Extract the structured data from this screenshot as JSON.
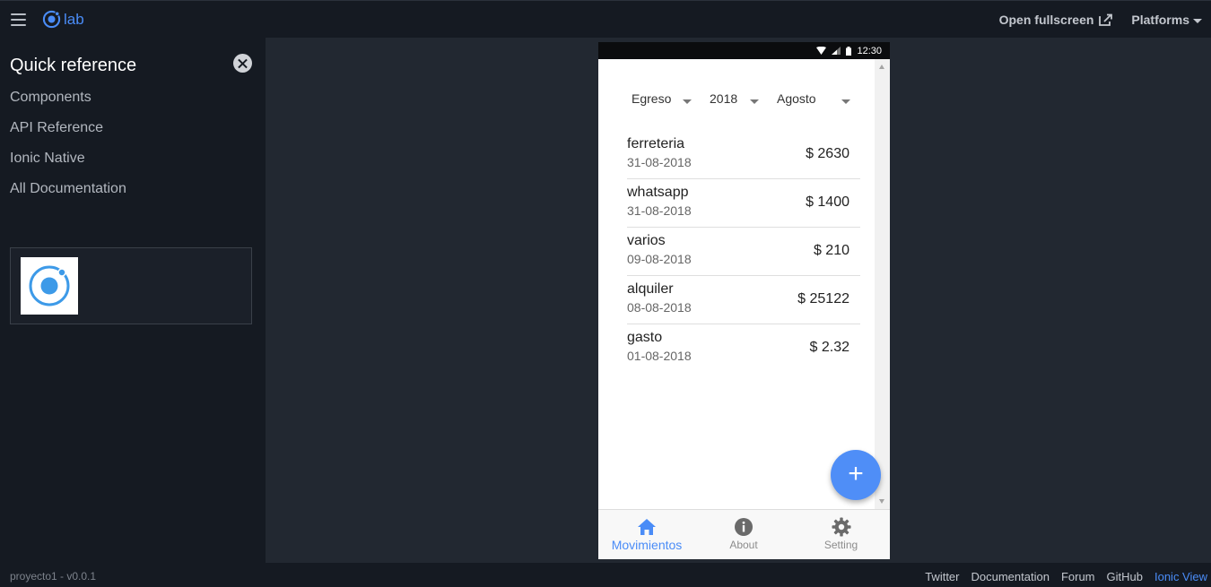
{
  "topbar": {
    "brand_text": "lab",
    "open_fullscreen": "Open fullscreen",
    "platforms": "Platforms"
  },
  "sidebar": {
    "title": "Quick reference",
    "links": [
      "Components",
      "API Reference",
      "Ionic Native",
      "All Documentation"
    ]
  },
  "device": {
    "time": "12:30"
  },
  "filters": {
    "type": "Egreso",
    "year": "2018",
    "month": "Agosto"
  },
  "transactions": [
    {
      "name": "ferreteria",
      "date": "31-08-2018",
      "amount": "$ 2630"
    },
    {
      "name": "whatsapp",
      "date": "31-08-2018",
      "amount": "$ 1400"
    },
    {
      "name": "varios",
      "date": "09-08-2018",
      "amount": "$ 210"
    },
    {
      "name": "alquiler",
      "date": "08-08-2018",
      "amount": "$ 25122"
    },
    {
      "name": "gasto",
      "date": "01-08-2018",
      "amount": "$ 2.32"
    }
  ],
  "fab_label": "+",
  "tabs": [
    {
      "label": "Movimientos",
      "icon": "home-icon",
      "active": true
    },
    {
      "label": "About",
      "icon": "info-icon",
      "active": false
    },
    {
      "label": "Setting",
      "icon": "gear-icon",
      "active": false
    }
  ],
  "footer": {
    "version": "proyecto1 - v0.0.1",
    "links": [
      "Twitter",
      "Documentation",
      "Forum",
      "GitHub",
      "Ionic View"
    ]
  },
  "colors": {
    "accent": "#4a8cf7",
    "fab": "#4f8ef7",
    "chrome_bg": "#151a22",
    "workspace_bg": "#222831"
  }
}
